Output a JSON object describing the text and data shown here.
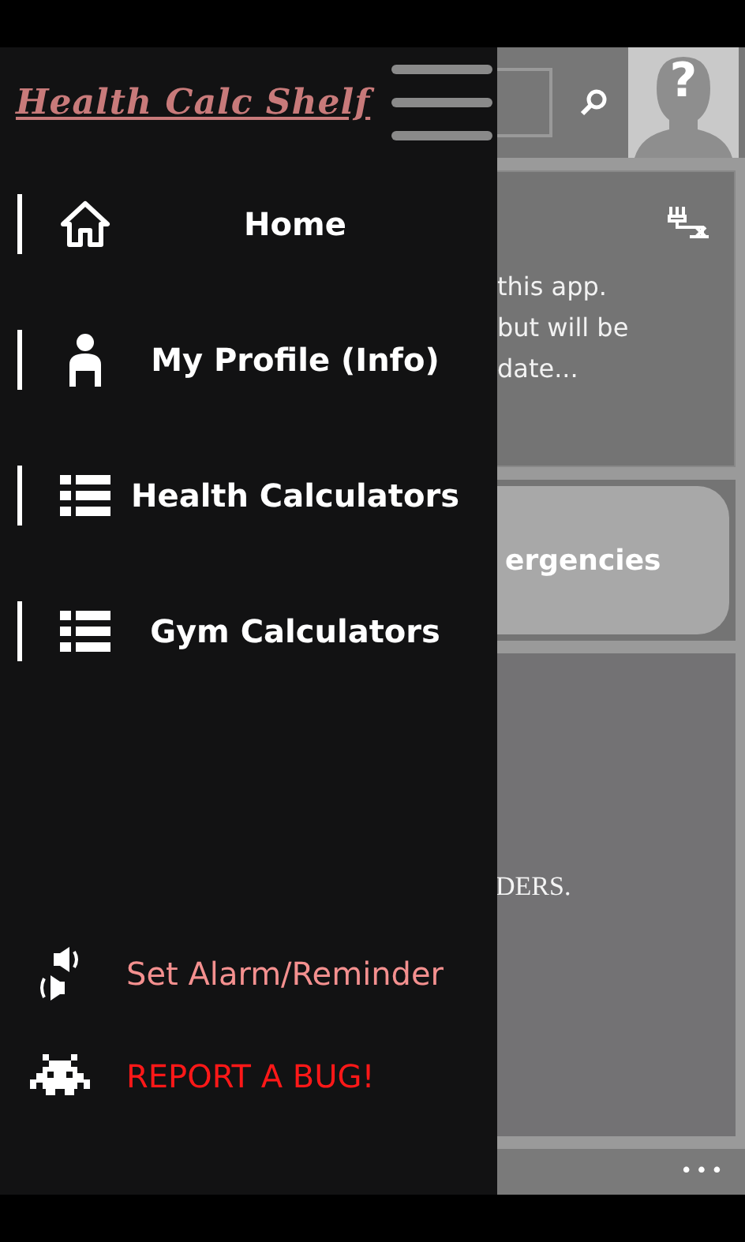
{
  "header": {
    "avatar_mark": "?"
  },
  "notice_board": {
    "lines": [
      "this app.",
      "but will be",
      "date..."
    ]
  },
  "first_aid": {
    "label": "ergencies"
  },
  "reminders": {
    "text": "DERS."
  },
  "drawer": {
    "title": "Health Calc Shelf",
    "items": [
      {
        "kind": "home",
        "label": "Home"
      },
      {
        "kind": "profile",
        "label": "My Profile (Info)"
      },
      {
        "kind": "list",
        "label": "Health Calculators"
      },
      {
        "kind": "list",
        "label": "Gym Calculators"
      }
    ],
    "actions": [
      {
        "kind": "alarm",
        "label": "Set Alarm/Reminder",
        "color": "#f4908f"
      },
      {
        "kind": "bug",
        "label": "REPORT A BUG!",
        "color": "#ff1818"
      }
    ]
  },
  "app_bar": {
    "more": "•••"
  }
}
